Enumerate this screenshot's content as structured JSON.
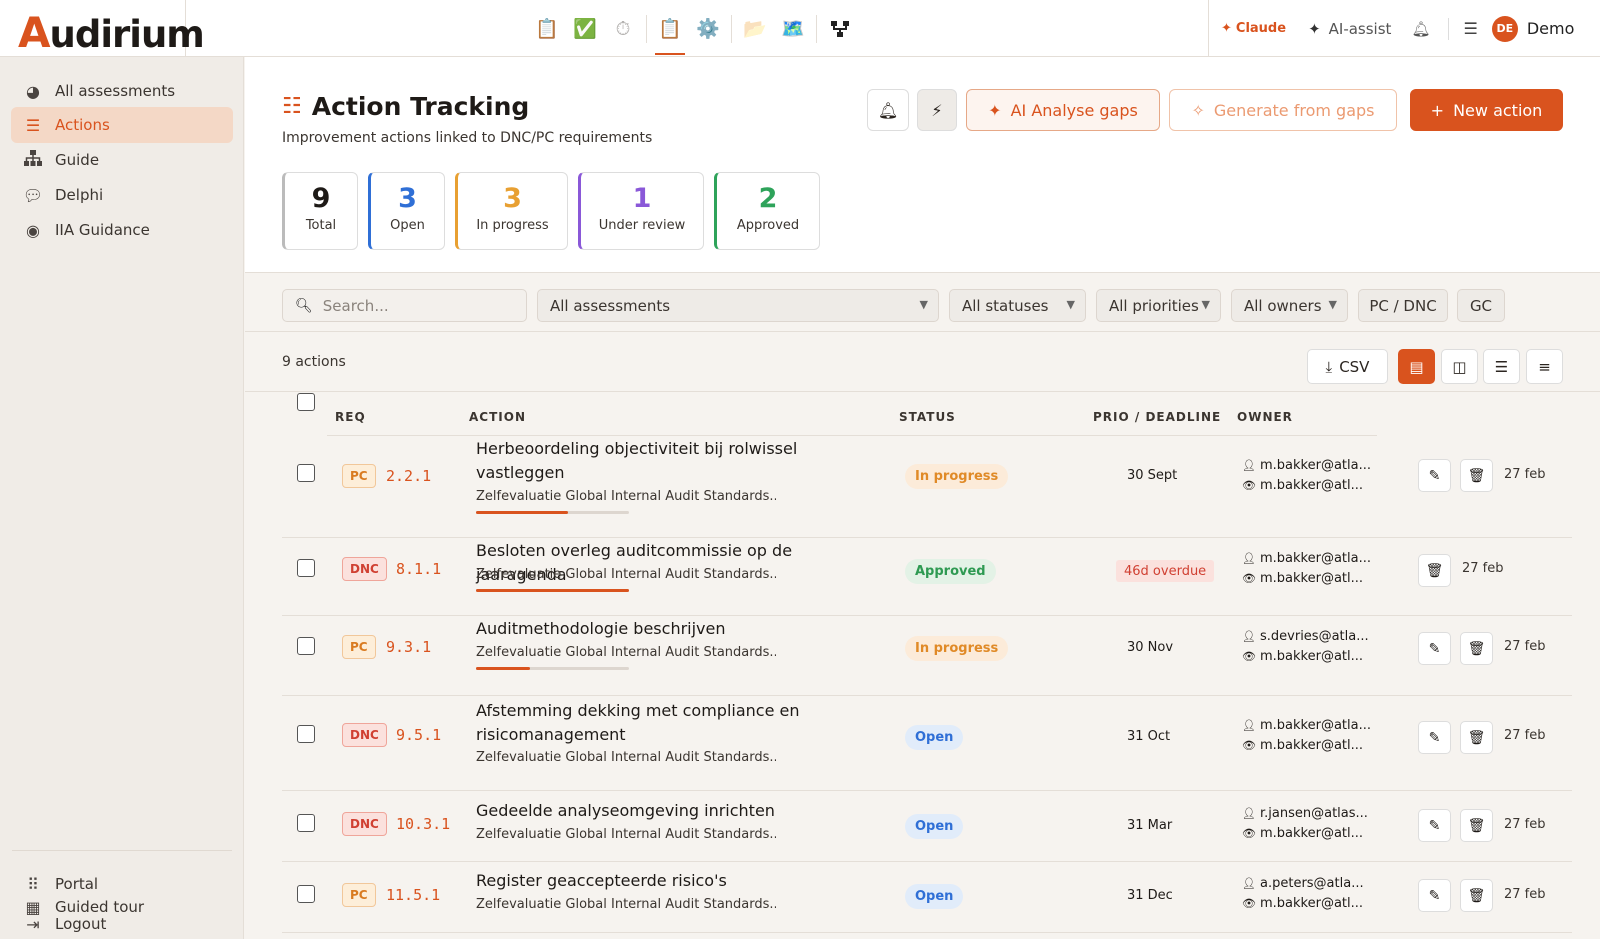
{
  "app": {
    "logo": "Audirium",
    "top_icons": [
      "clipboard-icon",
      "checkmark-icon",
      "timer-icon",
      "clipboard-icon",
      "gear-icon",
      "folders-icon",
      "map-icon",
      "network-icon"
    ],
    "claude_label": "Claude",
    "ai_assist_label": "AI-assist",
    "user_initials": "DE",
    "user_name": "Demo"
  },
  "sidebar": {
    "items": [
      {
        "label": "All assessments",
        "icon": "chart-pie-icon"
      },
      {
        "label": "Actions",
        "icon": "list-check-icon"
      },
      {
        "label": "Guide",
        "icon": "sitemap-icon"
      },
      {
        "label": "Delphi",
        "icon": "comments-icon"
      },
      {
        "label": "IIA Guidance",
        "icon": "compass-icon"
      }
    ],
    "bottom_items": [
      {
        "label": "Portal",
        "icon": "grid-icon"
      },
      {
        "label": "Logout",
        "icon": "logout-icon"
      },
      {
        "label": "Guided tour",
        "icon": "map-icon"
      }
    ]
  },
  "header": {
    "title": "Action Tracking",
    "subtitle": "Improvement actions linked to DNC/PC requirements",
    "ai_button": "AI Analyse gaps",
    "generate_button": "Generate from gaps",
    "new_button": "New action"
  },
  "stats": [
    {
      "value": "9",
      "label": "Total"
    },
    {
      "value": "3",
      "label": "Open"
    },
    {
      "value": "3",
      "label": "In progress"
    },
    {
      "value": "1",
      "label": "Under review"
    },
    {
      "value": "2",
      "label": "Approved"
    }
  ],
  "filters": {
    "search_placeholder": "Search...",
    "assessment": "All assessments",
    "status": "All statuses",
    "priority": "All priorities",
    "owner": "All owners",
    "pc_dnc": "PC / DNC",
    "gc": "GC"
  },
  "toolbar": {
    "count": "9 actions",
    "csv": "CSV"
  },
  "table": {
    "headers": {
      "req": "REQ",
      "action": "ACTION",
      "status": "STATUS",
      "prio": "PRIO / DEADLINE",
      "owner": "OWNER"
    },
    "rows": [
      {
        "tag": "PC",
        "req": "2.2.1",
        "title": "Herbeoordeling objectiviteit bij rolwissel vastleggen",
        "sub": "Zelfevaluatie Global Internal Audit Standards...",
        "progress": 0.6,
        "status": "In progress",
        "deadline": "30 Sept",
        "overdue": "",
        "owner": "m.bakker@atla...",
        "watcher": "m.bakker@atl...",
        "date": "27 feb"
      },
      {
        "tag": "DNC",
        "req": "8.1.1",
        "title": "Besloten overleg auditcommissie op de jaaragenda",
        "sub": "Zelfevaluatie Global Internal Audit Standards...",
        "progress": 1.0,
        "status": "Approved",
        "deadline": "",
        "overdue": "46d overdue",
        "owner": "m.bakker@atla...",
        "watcher": "m.bakker@atl...",
        "date": "27 feb"
      },
      {
        "tag": "PC",
        "req": "9.3.1",
        "title": "Auditmethodologie beschrijven",
        "sub": "Zelfevaluatie Global Internal Audit Standards...",
        "progress": 0.35,
        "status": "In progress",
        "deadline": "30 Nov",
        "overdue": "",
        "owner": "s.devries@atla...",
        "watcher": "m.bakker@atl...",
        "date": "27 feb"
      },
      {
        "tag": "DNC",
        "req": "9.5.1",
        "title": "Afstemming dekking met compliance en risicomanagement",
        "sub": "Zelfevaluatie Global Internal Audit Standards...",
        "progress": 0,
        "status": "Open",
        "deadline": "31 Oct",
        "overdue": "",
        "owner": "m.bakker@atla...",
        "watcher": "m.bakker@atl...",
        "date": "27 feb"
      },
      {
        "tag": "DNC",
        "req": "10.3.1",
        "title": "Gedeelde analyseomgeving inrichten",
        "sub": "Zelfevaluatie Global Internal Audit Standards...",
        "progress": 0,
        "status": "Open",
        "deadline": "31 Mar",
        "overdue": "",
        "owner": "r.jansen@atlas...",
        "watcher": "m.bakker@atl...",
        "date": "27 feb"
      },
      {
        "tag": "PC",
        "req": "11.5.1",
        "title": "Register geaccepteerde risico's",
        "sub": "Zelfevaluatie Global Internal Audit Standards...",
        "progress": 0,
        "status": "Open",
        "deadline": "31 Dec",
        "overdue": "",
        "owner": "a.peters@atla...",
        "watcher": "m.bakker@atl...",
        "date": "27 feb"
      }
    ]
  },
  "colors": {
    "accent": "#d9531e",
    "open": "#2f6fd6",
    "in_progress": "#e8a032",
    "under_review": "#8a58d8",
    "approved": "#2ea35a",
    "dnc": "#d04032"
  }
}
